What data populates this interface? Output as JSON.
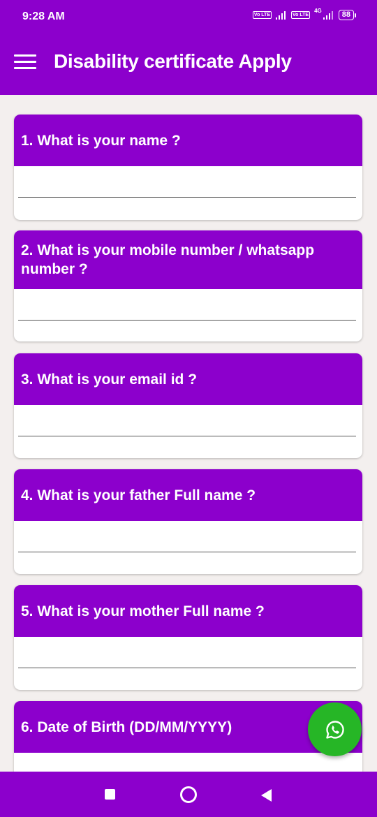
{
  "status_bar": {
    "time": "9:28 AM",
    "sim1_badge": "Vo LTE",
    "sim2_badge": "Vo LTE",
    "network_type": "4G",
    "battery_level": "88"
  },
  "app_bar": {
    "title": "Disability certificate Apply",
    "menu_icon": "hamburger-menu-icon"
  },
  "questions": [
    {
      "label": "1. What is your name ?",
      "value": ""
    },
    {
      "label": "2. What is your mobile number / whatsapp number ?",
      "value": ""
    },
    {
      "label": "3. What is your email id ?",
      "value": ""
    },
    {
      "label": "4. What is your father Full name ?",
      "value": ""
    },
    {
      "label": "5. What is your mother Full name ?",
      "value": ""
    },
    {
      "label": "6. Date of Birth (DD/MM/YYYY)",
      "value": ""
    }
  ],
  "fab": {
    "icon": "whatsapp-icon"
  },
  "nav_bar": {
    "recents_icon": "square-recents-icon",
    "home_icon": "circle-home-icon",
    "back_icon": "triangle-back-icon"
  },
  "colors": {
    "primary": "#8c00cc",
    "background": "#f3efee",
    "card": "#ffffff",
    "fab": "#26b626"
  }
}
